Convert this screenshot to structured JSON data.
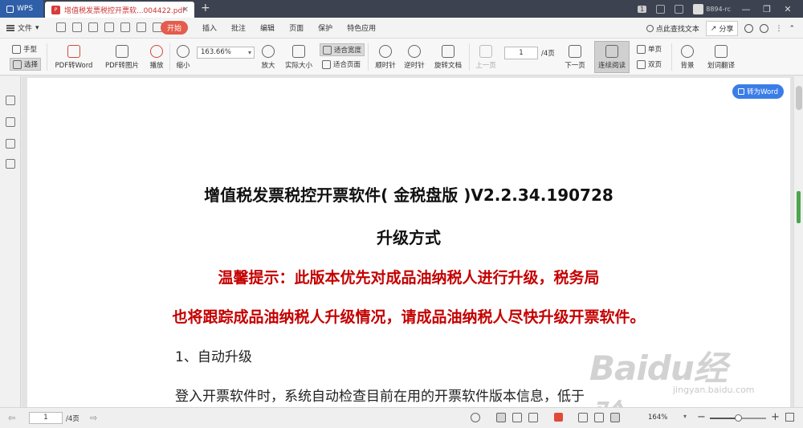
{
  "titlebar": {
    "app_label": "WPS",
    "doc_tab_title": "增值税发票税控开票软...004422.pdf",
    "page_count_badge": "1",
    "user_label": "8894-rc"
  },
  "menubar": {
    "file_label": "文件",
    "start_label": "开始",
    "menus": [
      "插入",
      "批注",
      "编辑",
      "页面",
      "保护",
      "特色应用"
    ],
    "search_label": "点此查找文本",
    "share_label": "分享"
  },
  "toolbar": {
    "hand_label": "手型",
    "select_label": "选择",
    "pdf_to_word": "PDF转Word",
    "pdf_to_image": "PDF转图片",
    "play": "播放",
    "zoom_out": "缩小",
    "zoom_value": "163.66%",
    "zoom_in": "放大",
    "actual_size": "实际大小",
    "fit_width": "适合宽度",
    "fit_page": "适合页面",
    "rotate_cw": "顺时针",
    "rotate_ccw": "逆时针",
    "rotate_doc": "旋转文档",
    "prev_page": "上一页",
    "current_page": "1",
    "page_total": "/4页",
    "next_page": "下一页",
    "continuous_read": "连续阅读",
    "single_page": "单页",
    "double_page": "双页",
    "background": "背景",
    "word_translate": "划词翻译"
  },
  "document": {
    "to_word_button": "转为Word",
    "title_line1": "增值税发票税控开票软件( 金税盘版 )V2.2.34.190728",
    "title_line2": "升级方式",
    "warning_line1": "温馨提示：此版本优先对成品油纳税人进行升级，税务局",
    "warning_line2": "也将跟踪成品油纳税人升级情况，请成品油纳税人尽快升级开票软件。",
    "section1": "1、自动升级",
    "paragraph1": "登入开票软件时，系统自动检查目前在用的开票软件版本信息，低于",
    "watermark_main": "Baidu经验",
    "watermark_sub": "jingyan.baidu.com"
  },
  "statusbar": {
    "current_page": "1",
    "page_total": "/4页",
    "zoom_label": "164%",
    "zoom_slider_fraction": 0.5
  }
}
